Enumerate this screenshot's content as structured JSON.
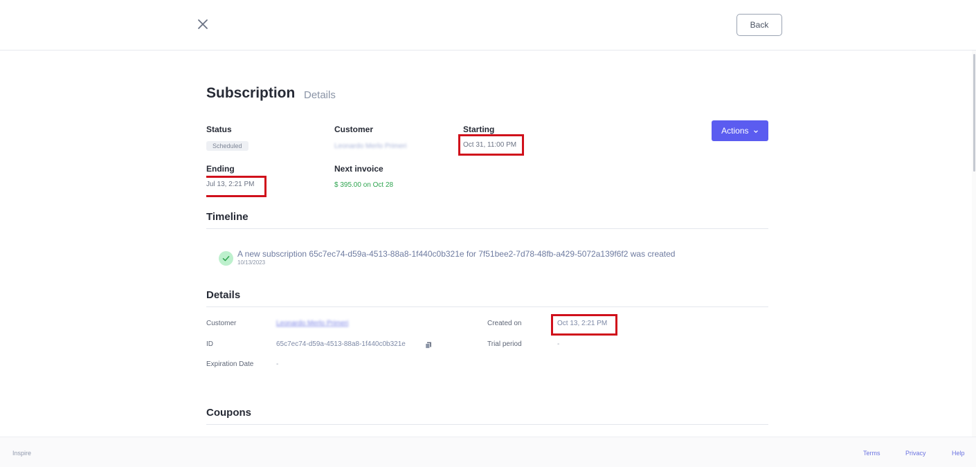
{
  "header": {
    "back_label": "Back"
  },
  "page": {
    "title": "Subscription",
    "subtitle": "Details"
  },
  "summary": {
    "status_label": "Status",
    "status_value": "Scheduled",
    "customer_label": "Customer",
    "customer_value": "Leonardo Merlo Primeri",
    "starting_label": "Starting",
    "starting_value": "Oct 31, 11:00 PM",
    "ending_label": "Ending",
    "ending_value": "Jul 13, 2:21 PM",
    "next_invoice_label": "Next invoice",
    "next_invoice_value": "$ 395.00 on Oct 28",
    "actions_label": "Actions"
  },
  "timeline": {
    "title": "Timeline",
    "events": [
      {
        "text": "A new subscription 65c7ec74-d59a-4513-88a8-1f440c0b321e for 7f51bee2-7d78-48fb-a429-5072a139f6f2 was created",
        "date": "10/13/2023"
      }
    ]
  },
  "details": {
    "title": "Details",
    "customer_label": "Customer",
    "customer_value": "Leonardo Merlo Primeri",
    "id_label": "ID",
    "id_value": "65c7ec74-d59a-4513-88a8-1f440c0b321e",
    "expiration_label": "Expiration Date",
    "expiration_value": "-",
    "created_label": "Created on",
    "created_value": "Oct 13, 2:21 PM",
    "trial_label": "Trial period",
    "trial_value": "-"
  },
  "coupons": {
    "title": "Coupons"
  },
  "footer": {
    "brand": "Inspire",
    "terms": "Terms",
    "privacy": "Privacy",
    "help": "Help"
  },
  "colors": {
    "accent": "#5b5cf0",
    "highlight": "#d0101b",
    "success": "#2ea44f"
  }
}
